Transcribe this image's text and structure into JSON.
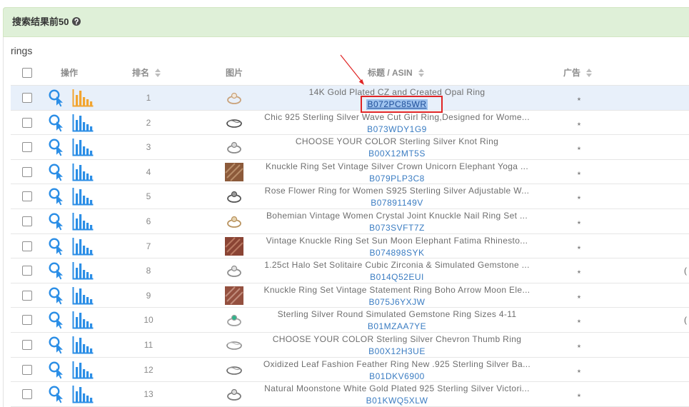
{
  "panel": {
    "title": "搜索结果前50"
  },
  "keyword": "rings",
  "columns": {
    "actions": "操作",
    "rank": "排名",
    "image": "图片",
    "title": "标题 / ASIN",
    "ad": "广告"
  },
  "icons": {
    "help": "help-icon",
    "sort": "sort-icon",
    "search_click": "search-click-icon",
    "chart": "bar-chart-icon"
  },
  "colors": {
    "heading_bg": "#dff0d8",
    "accent_blue": "#2b8ee6",
    "active_orange": "#f2a530",
    "link_blue": "#3a7cc2",
    "row_highlight": "#e8f0fa",
    "selection_bg": "#9ec2ee",
    "annotation_red": "#e02424"
  },
  "rows": [
    {
      "rank": "1",
      "title": "14K Gold Plated CZ and Created Opal Ring",
      "asin": "B072PC85WR",
      "ad": "*",
      "highlighted": true,
      "thumb": {
        "icon": "gold-opal-ring-icon",
        "kind": "ring",
        "color": "#c9a27a",
        "accent": "#f2e8dc"
      }
    },
    {
      "rank": "2",
      "title": "Chic 925 Sterling Silver Wave Cut Girl Ring,Designed for Wome...",
      "asin": "B073WDY1G9",
      "ad": "*",
      "thumb": {
        "icon": "silver-wave-ring-icon",
        "kind": "band",
        "color": "#444444",
        "accent": "#777777"
      }
    },
    {
      "rank": "3",
      "title": "CHOOSE YOUR COLOR Sterling Silver Knot Ring",
      "asin": "B00X12MT5S",
      "ad": "*",
      "thumb": {
        "icon": "silver-knot-ring-icon",
        "kind": "ring",
        "color": "#8a8a8a",
        "accent": "#d9d9d9"
      }
    },
    {
      "rank": "4",
      "title": "Knuckle Ring Set Vintage Silver Crown Unicorn Elephant Yoga ...",
      "asin": "B079PLP3C8",
      "ad": "*",
      "thumb": {
        "icon": "knuckle-ring-set-photo-icon",
        "kind": "photo",
        "color": "#8c5a3a",
        "accent": "#c9a07a"
      }
    },
    {
      "rank": "5",
      "title": "Rose Flower Ring for Women S925 Sterling Silver Adjustable W...",
      "asin": "B07891149V",
      "ad": "*",
      "thumb": {
        "icon": "rose-flower-ring-icon",
        "kind": "ring",
        "color": "#555555",
        "accent": "#9a9a9a"
      }
    },
    {
      "rank": "6",
      "title": "Bohemian Vintage Women Crystal Joint Knuckle Nail Ring Set ...",
      "asin": "B073SVFT7Z",
      "ad": "*",
      "thumb": {
        "icon": "crystal-knuckle-ring-set-icon",
        "kind": "ring",
        "color": "#b8925e",
        "accent": "#e6d3b0"
      }
    },
    {
      "rank": "7",
      "title": "Vintage Knuckle Ring Set Sun Moon Elephant Fatima Rhinesto...",
      "asin": "B074898SYK",
      "ad": "*",
      "thumb": {
        "icon": "sun-moon-ring-set-photo-icon",
        "kind": "photo",
        "color": "#8a4434",
        "accent": "#c88a70"
      }
    },
    {
      "rank": "8",
      "title": "1.25ct Halo Set Solitaire Cubic Zirconia & Simulated Gemstone ...",
      "asin": "B014Q52EUI",
      "ad": "*",
      "extra": "(",
      "thumb": {
        "icon": "halo-solitaire-ring-icon",
        "kind": "ring",
        "color": "#8d8d8d",
        "accent": "#e3e3e3"
      }
    },
    {
      "rank": "9",
      "title": "Knuckle Ring Set Vintage Statement Ring Boho Arrow Moon Ele...",
      "asin": "B075J6YXJW",
      "ad": "*",
      "thumb": {
        "icon": "boho-arrow-ring-set-photo-icon",
        "kind": "photo",
        "color": "#94503f",
        "accent": "#d0a090"
      }
    },
    {
      "rank": "10",
      "title": "Sterling Silver Round Simulated Gemstone Ring Sizes 4-11",
      "asin": "B01MZAA7YE",
      "ad": "*",
      "extra": "(",
      "thumb": {
        "icon": "green-gemstone-ring-icon",
        "kind": "ring",
        "color": "#a0a0a0",
        "accent": "#2fb38a"
      }
    },
    {
      "rank": "11",
      "title": "CHOOSE YOUR COLOR Sterling Silver Chevron Thumb Ring",
      "asin": "B00X12H3UE",
      "ad": "*",
      "thumb": {
        "icon": "chevron-thumb-ring-icon",
        "kind": "band",
        "color": "#8a8a8a",
        "accent": "#bbbbbb"
      }
    },
    {
      "rank": "12",
      "title": "Oxidized Leaf Fashion Feather Ring New .925 Sterling Silver Ba...",
      "asin": "B01DKV6900",
      "ad": "*",
      "thumb": {
        "icon": "leaf-feather-ring-icon",
        "kind": "band",
        "color": "#666666",
        "accent": "#999999"
      }
    },
    {
      "rank": "13",
      "title": "Natural Moonstone White Gold Plated 925 Sterling Silver Victori...",
      "asin": "B01KWQ5XLW",
      "ad": "*",
      "thumb": {
        "icon": "moonstone-ring-icon",
        "kind": "ring",
        "color": "#7a7a7a",
        "accent": "#dcdcdc"
      }
    }
  ]
}
